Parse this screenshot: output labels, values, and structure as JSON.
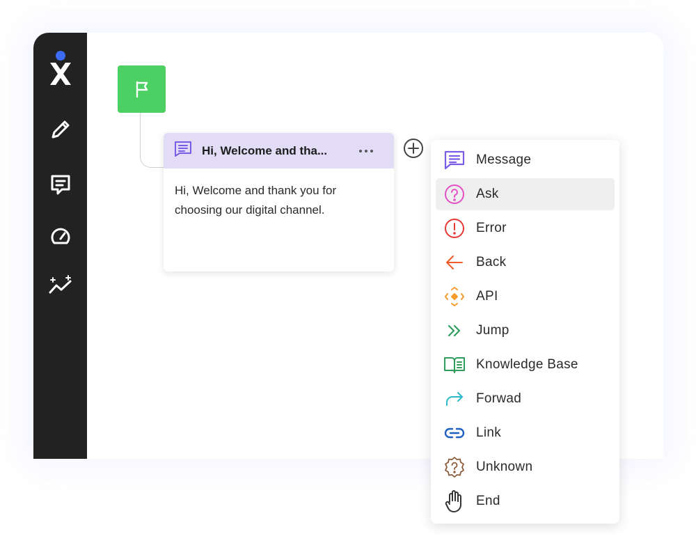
{
  "sidebar": {
    "items": [
      {
        "icon": "logo-icon"
      },
      {
        "icon": "pencil-icon"
      },
      {
        "icon": "chat-message-icon"
      },
      {
        "icon": "speedometer-icon"
      },
      {
        "icon": "sparkle-analytics-icon"
      }
    ],
    "background": "#222222",
    "accent": "#3d6bf2"
  },
  "start_node": {
    "icon": "flag-icon",
    "color": "#4ccf63"
  },
  "message_card": {
    "title": "Hi, Welcome and tha...",
    "body": "Hi, Welcome and thank you for choosing our digital channel.",
    "header_color": "#e3dcf7",
    "icon": "message-icon"
  },
  "add_button": {
    "icon": "plus-circle-icon"
  },
  "menu": {
    "items": [
      {
        "label": "Message",
        "icon": "message-icon",
        "color": "#7b5ce6"
      },
      {
        "label": "Ask",
        "icon": "question-icon",
        "color": "#e34fc4",
        "active": true
      },
      {
        "label": "Error",
        "icon": "error-icon",
        "color": "#e53935"
      },
      {
        "label": "Back",
        "icon": "arrow-left-icon",
        "color": "#f05a28"
      },
      {
        "label": "API",
        "icon": "api-icon",
        "color": "#f59a2b"
      },
      {
        "label": "Jump",
        "icon": "double-chevron-icon",
        "color": "#2e9c5a"
      },
      {
        "label": "Knowledge Base",
        "icon": "book-icon",
        "color": "#2e9c5a"
      },
      {
        "label": "Forwad",
        "icon": "forward-arrow-icon",
        "color": "#2bb8c9"
      },
      {
        "label": "Link",
        "icon": "link-icon",
        "color": "#1f5fbf"
      },
      {
        "label": "Unknown",
        "icon": "unknown-badge-icon",
        "color": "#8a5a3a"
      },
      {
        "label": "End",
        "icon": "hand-stop-icon",
        "color": "#333333"
      }
    ]
  }
}
